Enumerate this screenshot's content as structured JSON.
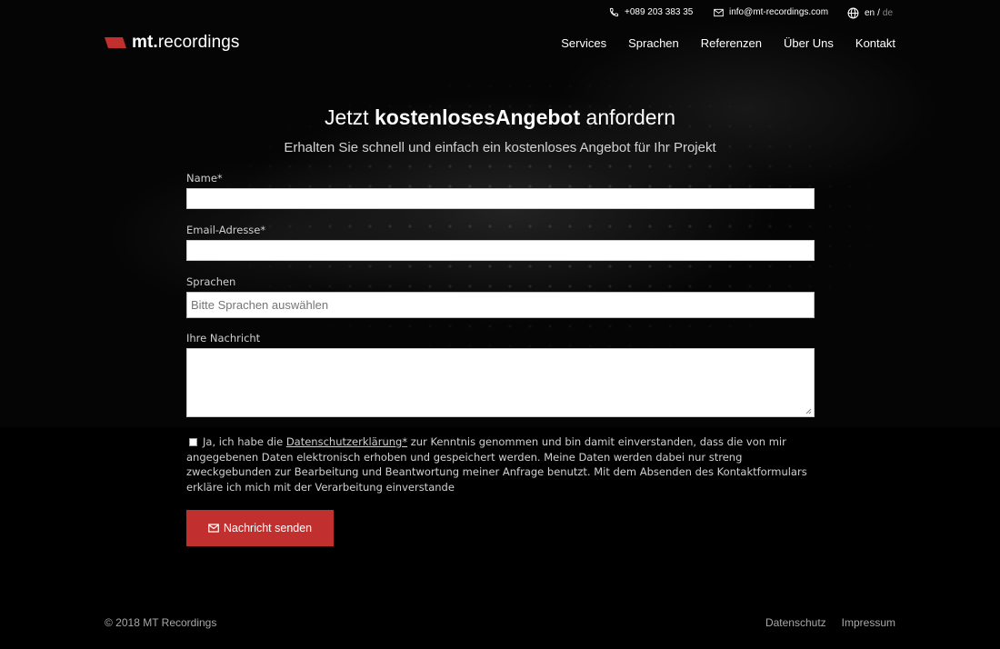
{
  "topbar": {
    "phone": "+089 203 383 35",
    "email": "info@mt-recordings.com",
    "lang_active": "en",
    "lang_sep": "/",
    "lang_inactive": "de"
  },
  "brand": {
    "logo_bold": "mt.",
    "logo_rest": "recordings",
    "accent": "#c1302f"
  },
  "nav": {
    "items": [
      "Services",
      "Sprachen",
      "Referenzen",
      "Über Uns",
      "Kontakt"
    ]
  },
  "hero": {
    "title_pre": "Jetzt ",
    "title_bold": "kostenlosesAngebot",
    "title_post": " anfordern",
    "subtitle": "Erhalten Sie schnell und einfach ein kostenloses Angebot für Ihr Projekt"
  },
  "form": {
    "name_label": "Name*",
    "name_value": "",
    "email_label": "Email-Adresse*",
    "email_value": "",
    "languages_label": "Sprachen",
    "languages_placeholder": "Bitte Sprachen auswählen",
    "message_label": "Ihre Nachricht",
    "message_value": "",
    "consent_pre": "Ja, ich habe die ",
    "consent_link": "Datenschutzerklärung*",
    "consent_post": " zur Kenntnis genommen und bin damit einverstanden, dass die von mir angegebenen Daten elektronisch erhoben und gespeichert werden. Meine Daten werden dabei nur streng zweckgebunden zur Bearbeitung und Beantwortung meiner Anfrage benutzt. Mit dem Absenden des Kontaktformulars erkläre ich mich mit der Verarbeitung einverstande",
    "submit_label": "Nachricht senden"
  },
  "footer": {
    "copyright": "© 2018 MT Recordings",
    "links": [
      "Datenschutz",
      "Impressum"
    ]
  }
}
